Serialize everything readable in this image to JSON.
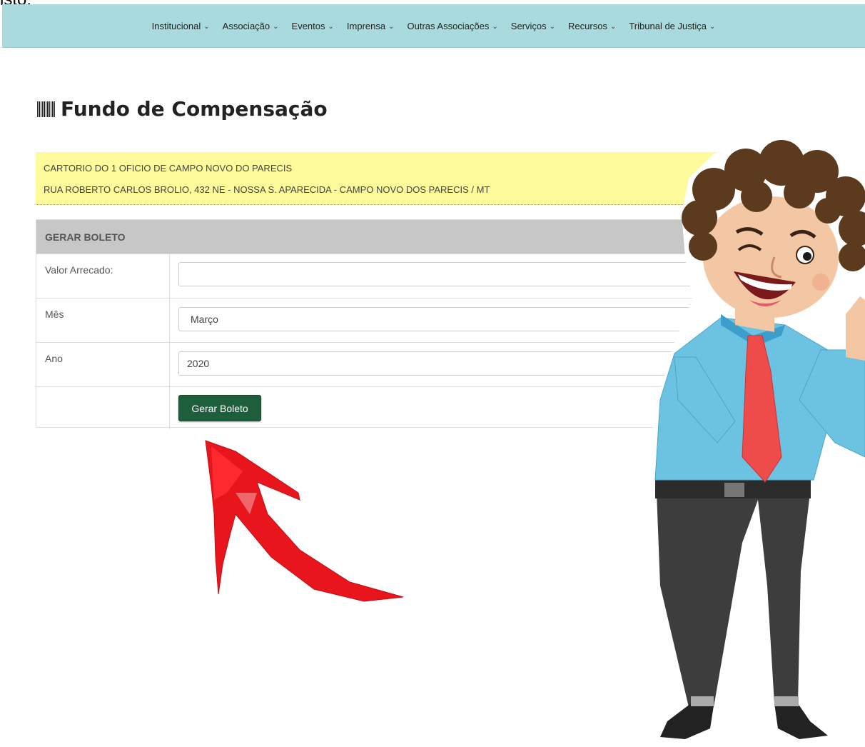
{
  "cut_text": "isto.",
  "nav": {
    "items": [
      {
        "label": "Institucional"
      },
      {
        "label": "Associação"
      },
      {
        "label": "Eventos"
      },
      {
        "label": "Imprensa"
      },
      {
        "label": "Outras Associações"
      },
      {
        "label": "Serviços"
      },
      {
        "label": "Recursos"
      },
      {
        "label": "Tribunal de Justiça"
      }
    ],
    "chevron_icon": "chevron-down-icon"
  },
  "page": {
    "title": "Fundo de Compensação",
    "title_icon": "barcode-icon"
  },
  "office": {
    "name": "CARTORIO DO 1 OFICIO DE CAMPO NOVO DO PARECIS",
    "address": "RUA ROBERTO CARLOS BROLIO, 432 NE - NOSSA S. APARECIDA - CAMPO NOVO DOS PARECIS / MT"
  },
  "form": {
    "header": "GERAR BOLETO",
    "valor_label": "Valor Arrecado:",
    "valor_value": "",
    "mes_label": "Mês",
    "mes_value": "Março",
    "ano_label": "Ano",
    "ano_value": "2020",
    "submit_label": "Gerar Boleto"
  },
  "colors": {
    "navbar": "#a8dade",
    "info_box": "#fdfb9b",
    "form_header": "#c7c7c7",
    "button": "#1d5e3c",
    "arrow": "#e8161c"
  }
}
